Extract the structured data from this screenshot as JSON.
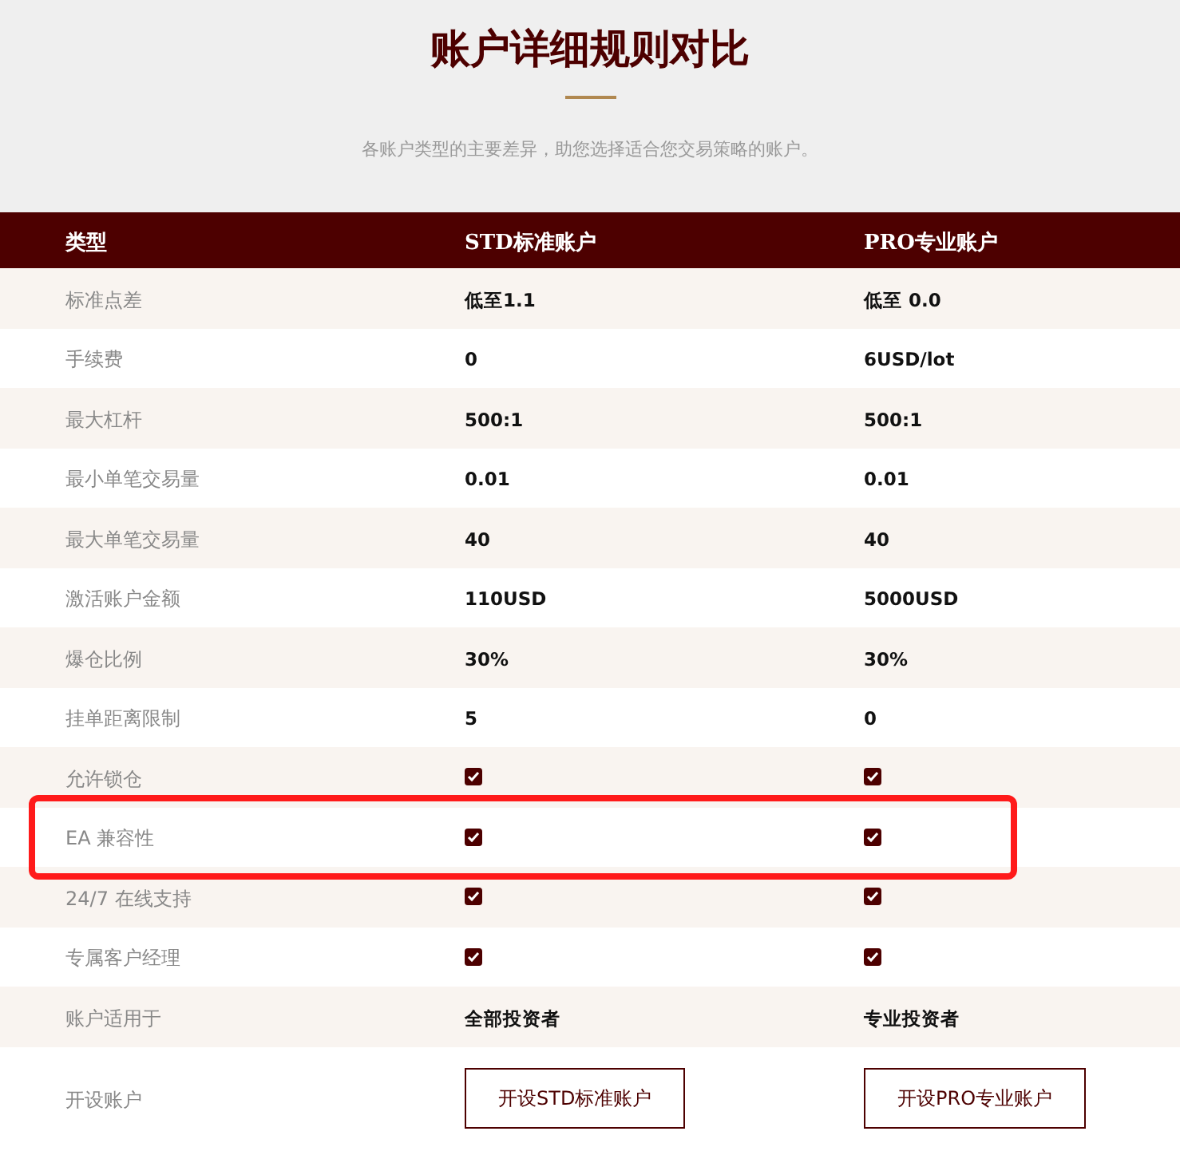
{
  "title": "账户详细规则对比",
  "subtitle": "各账户类型的主要差异，助您选择适合您交易策略的账户。",
  "columns": [
    "类型",
    "STD标准账户",
    "PRO专业账户"
  ],
  "rows": [
    {
      "label": "标准点差",
      "highlighted": false,
      "cells": [
        {
          "kind": "text",
          "text": "低至1.1"
        },
        {
          "kind": "text",
          "text": "低至 0.0"
        }
      ]
    },
    {
      "label": "手续费",
      "highlighted": false,
      "cells": [
        {
          "kind": "text",
          "text": "0"
        },
        {
          "kind": "text",
          "text": "6USD/lot"
        }
      ]
    },
    {
      "label": "最大杠杆",
      "highlighted": false,
      "cells": [
        {
          "kind": "text",
          "text": "500:1"
        },
        {
          "kind": "text",
          "text": "500:1"
        }
      ]
    },
    {
      "label": "最小单笔交易量",
      "highlighted": false,
      "cells": [
        {
          "kind": "text",
          "text": "0.01"
        },
        {
          "kind": "text",
          "text": "0.01"
        }
      ]
    },
    {
      "label": "最大单笔交易量",
      "highlighted": false,
      "cells": [
        {
          "kind": "text",
          "text": "40"
        },
        {
          "kind": "text",
          "text": "40"
        }
      ]
    },
    {
      "label": "激活账户金额",
      "highlighted": false,
      "cells": [
        {
          "kind": "text",
          "text": "110USD"
        },
        {
          "kind": "text",
          "text": "5000USD"
        }
      ]
    },
    {
      "label": "爆仓比例",
      "highlighted": false,
      "cells": [
        {
          "kind": "text",
          "text": "30%"
        },
        {
          "kind": "text",
          "text": "30%"
        }
      ]
    },
    {
      "label": "挂单距离限制",
      "highlighted": false,
      "cells": [
        {
          "kind": "text",
          "text": "5"
        },
        {
          "kind": "text",
          "text": "0"
        }
      ]
    },
    {
      "label": "允许锁仓",
      "highlighted": false,
      "cells": [
        {
          "kind": "check",
          "checked": true
        },
        {
          "kind": "check",
          "checked": true
        }
      ]
    },
    {
      "label": "EA 兼容性",
      "highlighted": true,
      "cells": [
        {
          "kind": "check",
          "checked": true
        },
        {
          "kind": "check",
          "checked": true
        }
      ]
    },
    {
      "label": "24/7 在线支持",
      "highlighted": false,
      "cells": [
        {
          "kind": "check",
          "checked": true
        },
        {
          "kind": "check",
          "checked": true
        }
      ]
    },
    {
      "label": "专属客户经理",
      "highlighted": false,
      "cells": [
        {
          "kind": "check",
          "checked": true
        },
        {
          "kind": "check",
          "checked": true
        }
      ]
    },
    {
      "label": "账户适用于",
      "highlighted": false,
      "cells": [
        {
          "kind": "text",
          "text": "全部投资者"
        },
        {
          "kind": "text",
          "text": "专业投资者"
        }
      ]
    },
    {
      "label": "开设账户",
      "highlighted": false,
      "cells": [
        {
          "kind": "button",
          "text": "开设STD标准账户"
        },
        {
          "kind": "button",
          "text": "开设PRO专业账户"
        }
      ]
    }
  ]
}
